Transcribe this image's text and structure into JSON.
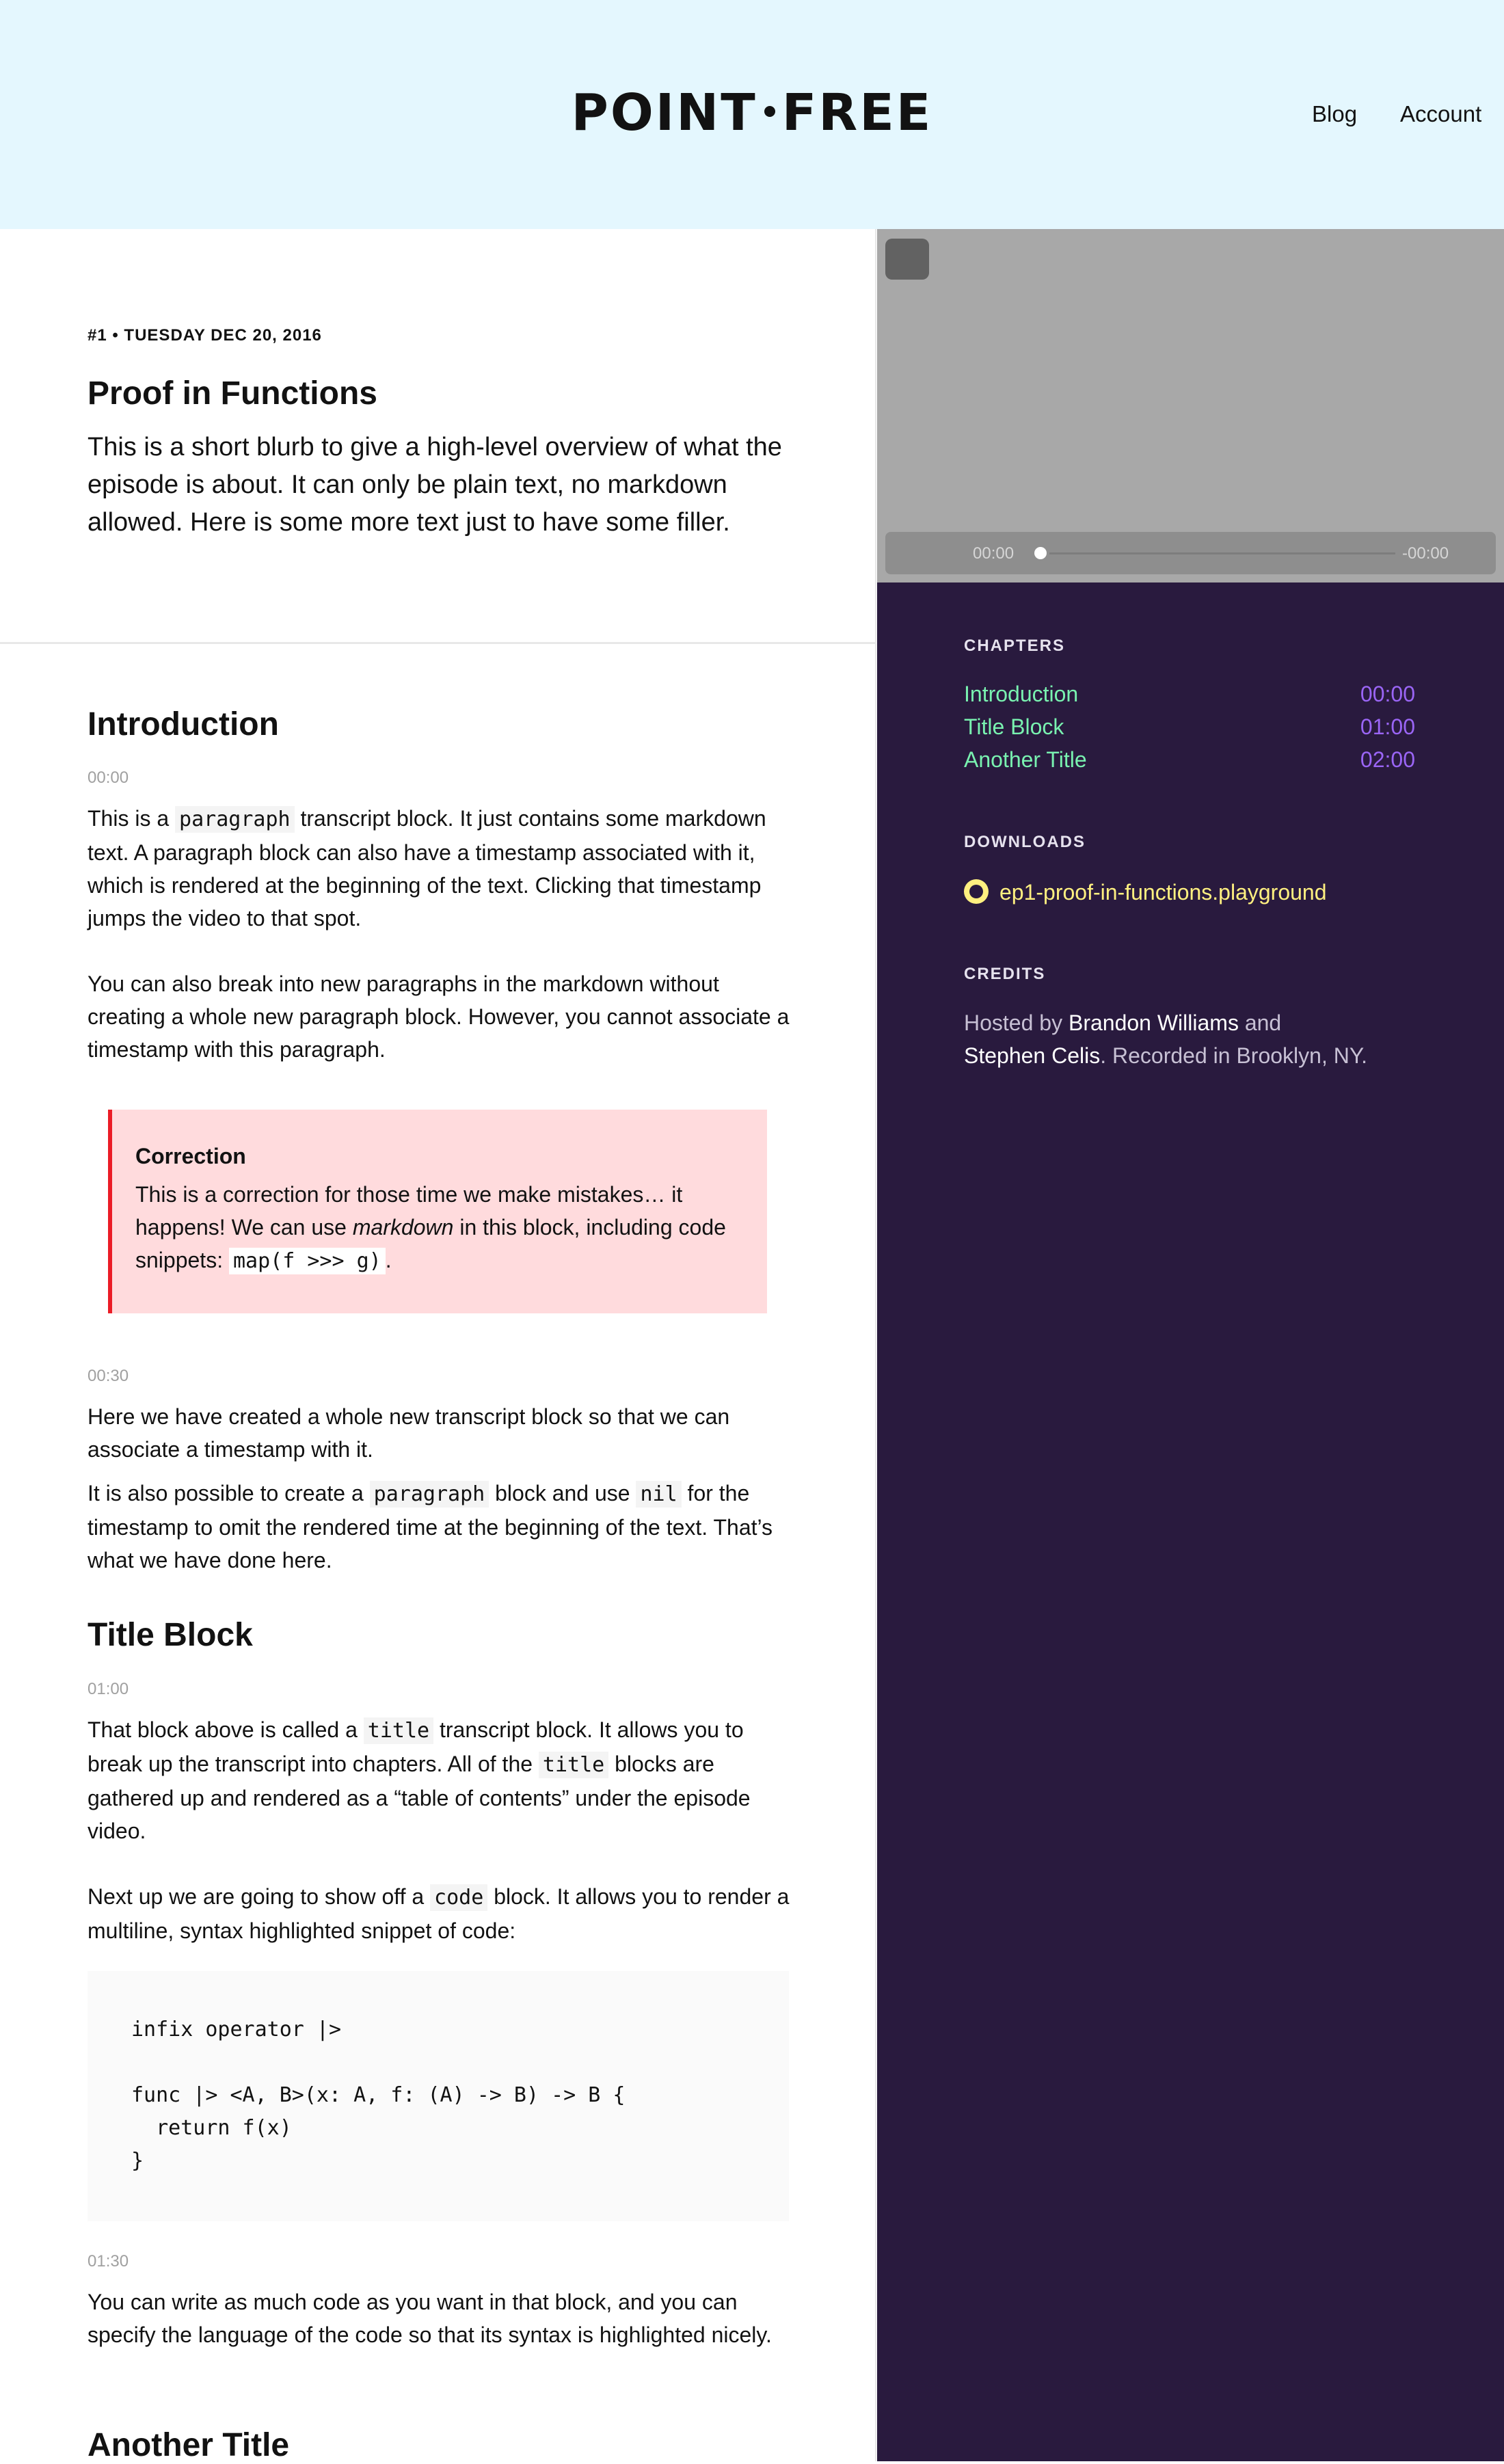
{
  "header": {
    "logo_left": "POINT",
    "logo_right": "FREE",
    "nav": {
      "blog": "Blog",
      "account": "Account"
    }
  },
  "video": {
    "current_time": "00:00",
    "remaining_time": "-00:00"
  },
  "episode": {
    "meta": "#1 • TUESDAY DEC 20, 2016",
    "title": "Proof in Functions",
    "blurb": "This is a short blurb to give a high-level overview of what the episode is about. It can only be plain text, no markdown allowed. Here is some more text just to have some filler."
  },
  "sidebar": {
    "chapters_heading": "CHAPTERS",
    "chapters": [
      {
        "title": "Introduction",
        "time": "00:00"
      },
      {
        "title": "Title Block",
        "time": "01:00"
      },
      {
        "title": "Another Title",
        "time": "02:00"
      }
    ],
    "downloads_heading": "DOWNLOADS",
    "download_file": "ep1-proof-in-functions.playground",
    "credits_heading": "CREDITS",
    "credits": {
      "prefix": "Hosted by ",
      "host1": "Brandon Williams",
      "mid": " and",
      "host2": "Stephen Celis",
      "suffix": ". Recorded in Brooklyn, NY."
    },
    "colors": {
      "background": "#291a3e",
      "chapter": "#79f2b0",
      "timestamp": "#9a65f5",
      "download": "#fff080"
    }
  },
  "transcript": {
    "intro": {
      "heading": "Introduction",
      "timestamp": "00:00",
      "p1": {
        "a": "This is a ",
        "code": "paragraph",
        "b": " transcript block. It just contains some markdown text. A paragraph block can also have a timestamp associated with it, which is rendered at the beginning of the text. Clicking that timestamp jumps the video to that spot."
      },
      "p2": "You can also break into new paragraphs in the markdown without creating a whole new paragraph block. However, you cannot associate a timestamp with this paragraph."
    },
    "correction": {
      "title": "Correction",
      "a": "This is a correction for those time we make mistakes… it happens! We can use ",
      "em": "markdown",
      "b": " in this block, including code snippets: ",
      "code": "map(f >>> g)",
      "c": "."
    },
    "block2": {
      "timestamp": "00:30",
      "p1": "Here we have created a whole new transcript block so that we can associate a timestamp with it.",
      "p2": {
        "a": "It is also possible to create a ",
        "code1": "paragraph",
        "b": " block and use ",
        "code2": "nil",
        "c": " for the timestamp to omit the rendered time at the beginning of the text. That’s what we have done here."
      }
    },
    "title_block": {
      "heading": "Title Block",
      "timestamp": "01:00",
      "p1": {
        "a": "That block above is called a ",
        "code1": "title",
        "b": " transcript block. It allows you to break up the transcript into chapters. All of the ",
        "code2": "title",
        "c": " blocks are gathered up and rendered as a “table of contents” under the episode video."
      },
      "p2": {
        "a": "Next up we are going to show off a ",
        "code": "code",
        "b": " block. It allows you to render a multiline, syntax highlighted snippet of code:"
      },
      "code_snippet": "infix operator |>\n\nfunc |> <A, B>(x: A, f: (A) -> B) -> B {\n  return f(x)\n}"
    },
    "block4": {
      "timestamp": "01:30",
      "p1": "You can write as much code as you want in that block, and you can specify the language of the code so that its syntax is highlighted nicely."
    },
    "another_title": {
      "heading": "Another Title"
    }
  }
}
